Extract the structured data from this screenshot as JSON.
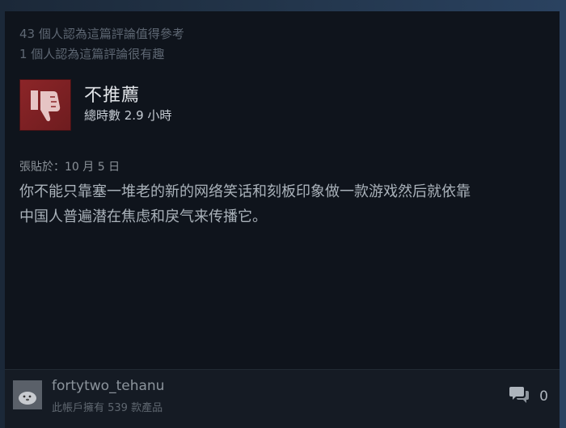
{
  "helpful": {
    "line1": "43 個人認為這篇評論值得參考",
    "line2": "1 個人認為這篇評論很有趣"
  },
  "verdict": {
    "title": "不推薦",
    "icon": "thumbs-down-icon",
    "hours": "總時數 2.9 小時"
  },
  "posted": "張貼於：10 月 5 日",
  "review": {
    "line1": "你不能只靠塞一堆老的新的网络笑话和刻板印象做一款游戏然后就依靠",
    "line2": "中国人普遍潜在焦虑和戾气来传播它。"
  },
  "author": {
    "name": "fortytwo_tehanu",
    "products": "此帳戶擁有 539 款產品",
    "avatar": "avatar"
  },
  "comments": {
    "icon": "comment-icon",
    "count": "0"
  },
  "colors": {
    "card_bg": "#0f141c",
    "not_recommended": "#8c2528",
    "page_bg": "#2a3f5a"
  }
}
